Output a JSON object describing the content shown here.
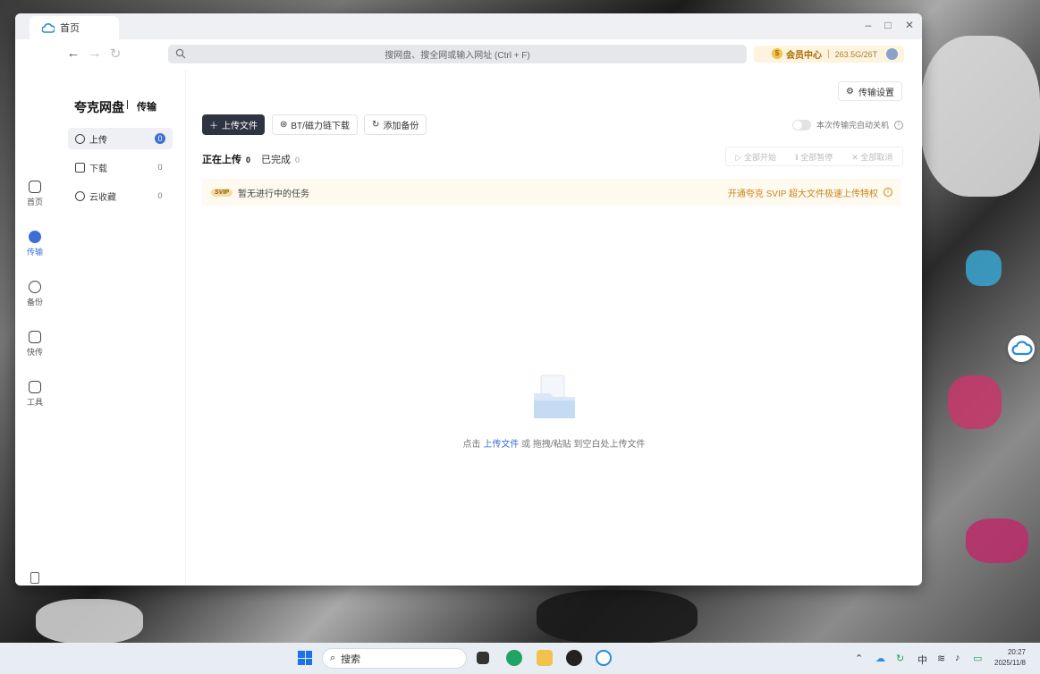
{
  "window": {
    "tab_title": "首页",
    "controls": {
      "minimize": "–",
      "maximize": "□",
      "close": "✕"
    }
  },
  "navbar": {
    "back": "←",
    "forward": "→",
    "refresh": "↻",
    "search_placeholder": "搜网盘、搜全网或输入网址 (Ctrl + F)",
    "vip_label": "会员中心",
    "vip_sep": "|",
    "storage": "263.5G/26T"
  },
  "rail": {
    "items": [
      {
        "label": "首页",
        "icon": "home-icon"
      },
      {
        "label": "传输",
        "icon": "transfer-icon"
      },
      {
        "label": "备份",
        "icon": "backup-icon"
      },
      {
        "label": "快传",
        "icon": "send-icon"
      },
      {
        "label": "工具",
        "icon": "toolbox-icon"
      }
    ]
  },
  "sidenav": {
    "brand": "夸克网盘",
    "section": "传输",
    "items": [
      {
        "label": "上传",
        "count": "0"
      },
      {
        "label": "下载",
        "count": "0"
      },
      {
        "label": "云收藏",
        "count": "0"
      }
    ]
  },
  "main": {
    "settings_label": "传输设置",
    "upload_btn": "上传文件",
    "bt_btn": "BT/磁力链下载",
    "backup_btn": "添加备份",
    "auto_shutdown": "本次传输完自动关机",
    "tabs": [
      {
        "label": "正在上传",
        "count": "0"
      },
      {
        "label": "已完成",
        "count": "0"
      }
    ],
    "actions": [
      "全部开始",
      "全部暂停",
      "全部取消"
    ],
    "notice_badge": "SVIP",
    "notice_text": "暂无进行中的任务",
    "promo_text": "开通夸克 SVIP 超大文件极速上传特权",
    "empty_prefix": "点击",
    "empty_link": "上传文件",
    "empty_suffix": "或 拖拽/粘贴 到空白处上传文件"
  },
  "taskbar": {
    "search_label": "搜索",
    "lang": "中",
    "time": "20:27",
    "date": "2025/11/8"
  },
  "colors": {
    "accent": "#3b6fd6",
    "primary_button": "#2e3441",
    "vip_bg": "#fdf3df",
    "promo": "#c7851a"
  }
}
